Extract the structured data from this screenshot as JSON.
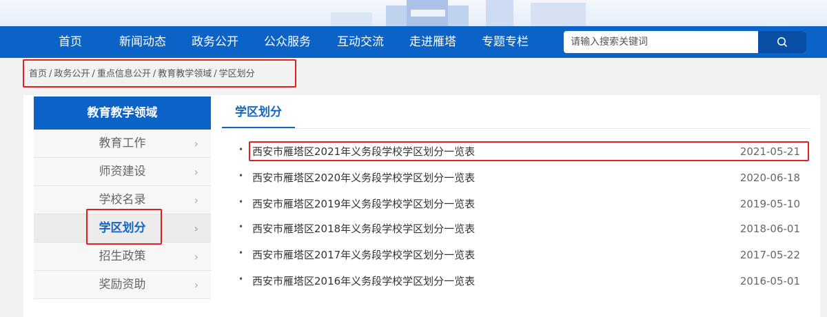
{
  "nav": {
    "items": [
      "首页",
      "新闻动态",
      "政务公开",
      "公众服务",
      "互动交流",
      "走进雁塔",
      "专题专栏"
    ]
  },
  "search": {
    "placeholder": "请输入搜索关键词",
    "button_icon": "search-icon"
  },
  "breadcrumb": {
    "items": [
      "首页",
      "政务公开",
      "重点信息公开",
      "教育教学领域",
      "学区划分"
    ],
    "separator": "/"
  },
  "sidebar": {
    "title": "教育教学领域",
    "items": [
      {
        "label": "教育工作"
      },
      {
        "label": "师资建设"
      },
      {
        "label": "学校名录"
      },
      {
        "label": "学区划分",
        "active": true
      },
      {
        "label": "招生政策"
      },
      {
        "label": "奖励资助"
      }
    ]
  },
  "main": {
    "section_title": "学区划分",
    "list": [
      {
        "title": "西安市雁塔区2021年义务段学校学区划分一览表",
        "date": "2021-05-21"
      },
      {
        "title": "西安市雁塔区2020年义务段学校学区划分一览表",
        "date": "2020-06-18"
      },
      {
        "title": "西安市雁塔区2019年义务段学校学区划分一览表",
        "date": "2019-05-10"
      },
      {
        "title": "西安市雁塔区2018年义务段学校学区划分一览表",
        "date": "2018-06-01"
      },
      {
        "title": "西安市雁塔区2017年义务段学校学区划分一览表",
        "date": "2017-05-22"
      },
      {
        "title": "西安市雁塔区2016年义务段学校学区划分一览表",
        "date": "2016-05-01"
      }
    ]
  },
  "colors": {
    "nav_blue": "#0b62c7",
    "accent_blue": "#1565c0",
    "highlight_red": "#e02020"
  }
}
